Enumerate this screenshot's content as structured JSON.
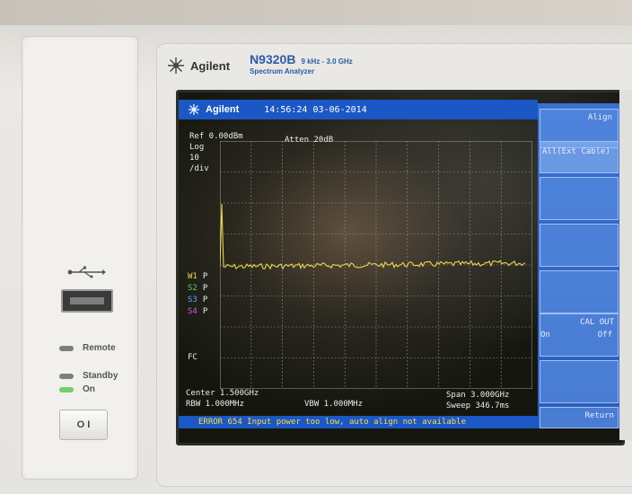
{
  "brand": {
    "name": "Agilent",
    "model": "N9320B",
    "freq_range": "9 kHz - 3.0 GHz",
    "description": "Spectrum Analyzer"
  },
  "front_panel": {
    "led_remote": "Remote",
    "led_standby": "Standby",
    "led_on": "On",
    "power_label": "O I"
  },
  "screen": {
    "header_brand": "Agilent",
    "datetime": "14:56:24 03-06-2014",
    "ref_level": "Ref 0.00dBm",
    "atten": "Atten 20dB",
    "scale_log": "Log",
    "scale_value": "10",
    "scale_unit": "/div",
    "trace_flags": [
      {
        "label": "W1",
        "mode": "P",
        "color": "#e8d94a"
      },
      {
        "label": "S2",
        "mode": "P",
        "color": "#4ad36b"
      },
      {
        "label": "S3",
        "mode": "P",
        "color": "#57a8ff"
      },
      {
        "label": "S4",
        "mode": "P",
        "color": "#d45ad8"
      }
    ],
    "coupling": "FC",
    "center": "Center 1.500GHz",
    "rbw": "RBW 1.000MHz",
    "vbw": "VBW 1.000MHz",
    "span": "Span 3.000GHz",
    "sweep": "Sweep 346.7ms",
    "error": "ERROR 654 Input power too low, auto align not available"
  },
  "softkeys": {
    "title": "Align",
    "all_label": "All(Ext Cable)",
    "cal_out": "CAL OUT",
    "cal_on": "On",
    "cal_off": "Off",
    "return": "Return"
  },
  "colors": {
    "screen_blue": "#1b57c5",
    "trace_yellow": "#e8d94a",
    "model_blue": "#2b5ca8"
  }
}
